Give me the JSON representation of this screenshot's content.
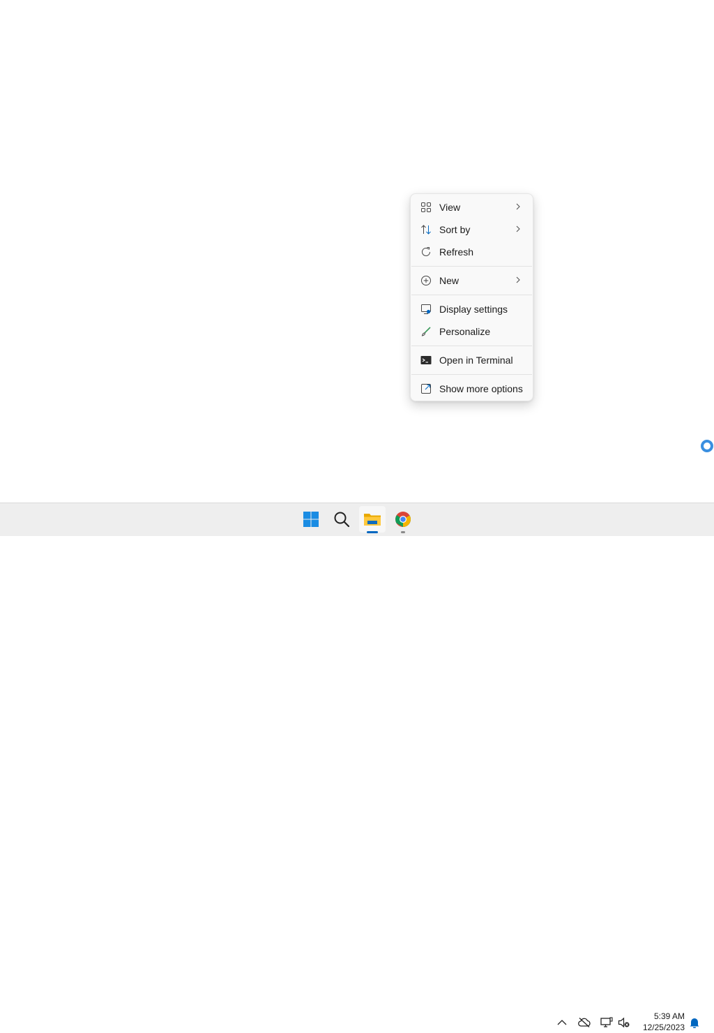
{
  "context_menu": {
    "items": [
      {
        "label": "View",
        "icon": "view-grid-icon",
        "submenu": true
      },
      {
        "label": "Sort by",
        "icon": "sort-icon",
        "submenu": true
      },
      {
        "label": "Refresh",
        "icon": "refresh-icon",
        "submenu": false
      },
      {
        "label": "New",
        "icon": "new-plus-icon",
        "submenu": true
      },
      {
        "label": "Display settings",
        "icon": "display-settings-icon",
        "submenu": false
      },
      {
        "label": "Personalize",
        "icon": "personalize-brush-icon",
        "submenu": false
      },
      {
        "label": "Open in Terminal",
        "icon": "terminal-icon",
        "submenu": false
      },
      {
        "label": "Show more options",
        "icon": "show-more-options-icon",
        "submenu": false
      }
    ]
  },
  "taskbar": {
    "apps": [
      {
        "name": "start",
        "icon": "windows-start-icon"
      },
      {
        "name": "search",
        "icon": "search-icon"
      },
      {
        "name": "file-explorer",
        "icon": "file-explorer-icon",
        "running": true,
        "active": true
      },
      {
        "name": "chrome",
        "icon": "chrome-icon",
        "running": true
      }
    ],
    "tray": {
      "icons": [
        "chevron-up-icon",
        "onedrive-offline-icon",
        "network-icon",
        "volume-muted-icon",
        "notification-bell-icon"
      ]
    },
    "clock": {
      "time": "5:39 AM",
      "date": "12/25/2023"
    }
  },
  "colors": {
    "accent": "#0067c0",
    "taskbar_bg": "#eeeeee",
    "menu_bg": "#f9f9f9"
  }
}
